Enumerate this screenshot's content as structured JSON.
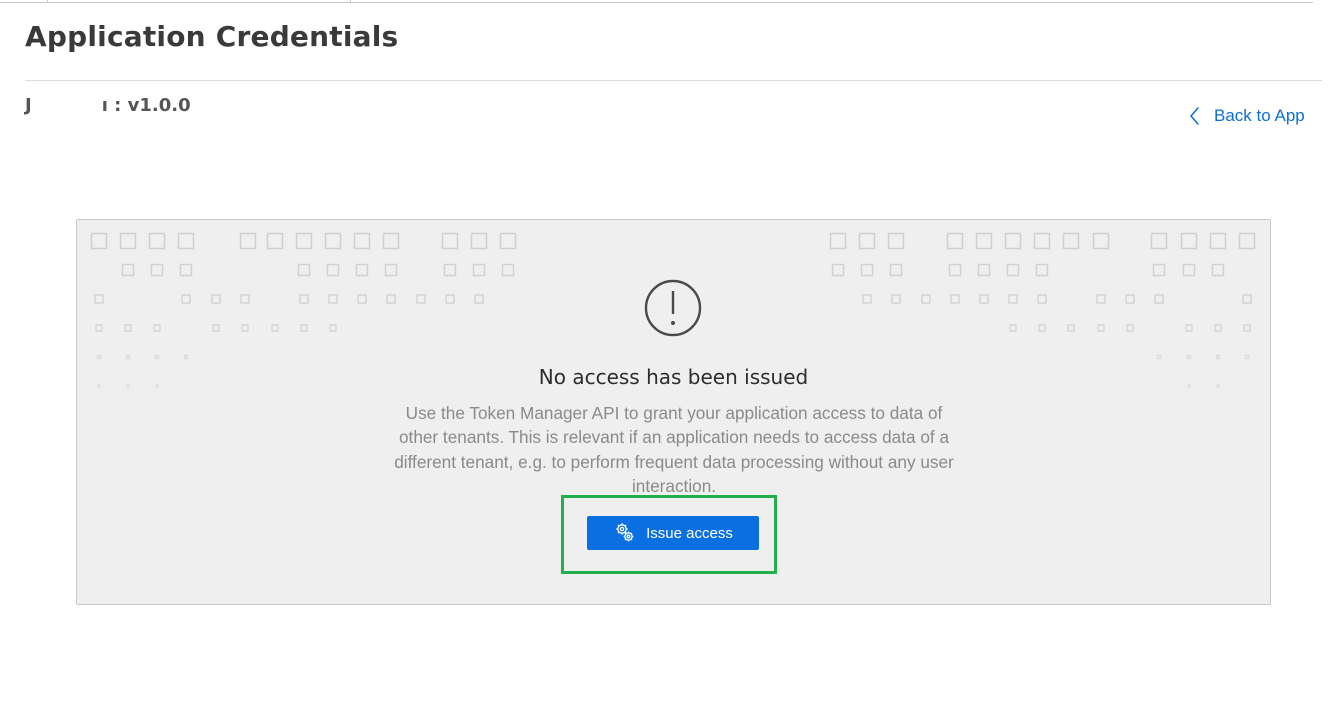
{
  "page": {
    "title": "Application Credentials",
    "app_name_prefix": "J",
    "app_name_suffix": "ı : v1.0.0"
  },
  "back_link": {
    "label": "Back to App"
  },
  "empty_state": {
    "icon": "alert-circle-icon",
    "title": "No access has been issued",
    "description": "Use the Token Manager API to grant your application access to data of other tenants. This is relevant if an application needs to access data of a different tenant, e.g. to perform frequent data processing without any user interaction.",
    "button_icon": "key-gear-icon",
    "button_label": "Issue access"
  },
  "colors": {
    "accent": "#0a6fe0",
    "link": "#0a6fd6",
    "highlight": "#22b04c",
    "panel_background": "#efefef"
  }
}
